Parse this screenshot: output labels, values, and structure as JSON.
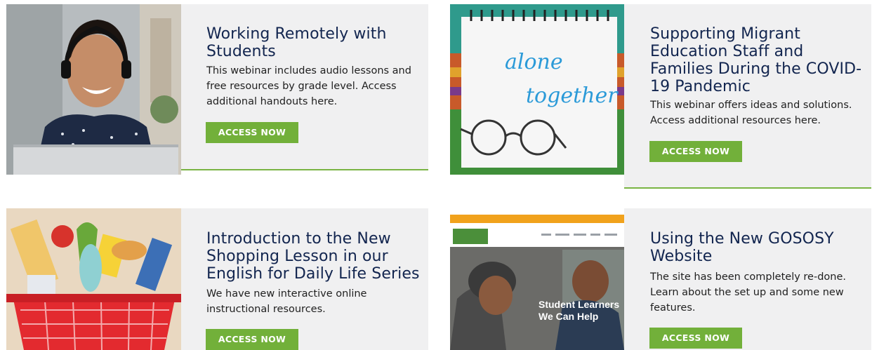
{
  "cards": [
    {
      "title": "Working Remotely with Students",
      "description": "This webinar includes audio lessons and free resources by grade level. Access additional handouts here.",
      "button_label": "ACCESS NOW",
      "image": "woman-with-headset-laptop"
    },
    {
      "title": "Supporting Migrant Education Staff and Families During the COVID-19 Pandemic",
      "description": "This webinar offers ideas and solutions. Access additional resources here.",
      "button_label": "ACCESS NOW",
      "image": "notepad-alone-together-glasses",
      "image_text_1": "alone",
      "image_text_2": "together"
    },
    {
      "title": "Introduction to the New Shopping Lesson in our English for Daily Life Series",
      "description": "We have new interactive online instructional resources.",
      "button_label": "ACCESS NOW",
      "image": "grocery-basket-illustration"
    },
    {
      "title": "Using the New GOSOSY Website",
      "description": "The site has been completely re-done. Learn about the set up and some new features.",
      "button_label": "ACCESS NOW",
      "image": "gososy-website-screenshot",
      "image_text_1": "Student Learners",
      "image_text_2": "We Can Help"
    }
  ],
  "colors": {
    "accent": "#72b03a",
    "title": "#12254f",
    "panel": "#f0f0f1"
  }
}
